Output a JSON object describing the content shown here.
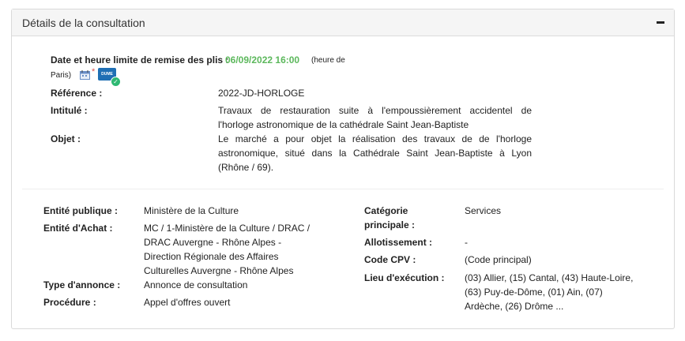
{
  "panel": {
    "title": "Détails de la consultation",
    "collapse_symbol": "−"
  },
  "deadline": {
    "label": "Date et heure limite de remise des plis :",
    "value": "06/09/2022 16:00",
    "tz_part1": "(heure de",
    "tz_part2": "Paris)",
    "icons": [
      "calendar-icon",
      "required-star-icon",
      "dume-icon"
    ],
    "dume_text": "DUME",
    "star": "*"
  },
  "reference": {
    "label": "Référence :",
    "value": "2022-JD-HORLOGE"
  },
  "intitule": {
    "label": "Intitulé :",
    "lines": [
      "Travaux de restauration suite à l'empoussièrement accidentel de",
      "l'horloge astronomique de la cathédrale Saint Jean-Baptiste"
    ]
  },
  "objet": {
    "label": "Objet :",
    "lines": [
      "Le marché a pour objet la réalisation des travaux de de l'horloge",
      "astronomique, situé dans la Cathédrale Saint Jean-Baptiste à Lyon",
      "(Rhône / 69)."
    ]
  },
  "entite_publique": {
    "label": "Entité publique :",
    "value": "Ministère de la Culture"
  },
  "entite_achat": {
    "label": "Entité d'Achat :",
    "lines": [
      "MC / 1-Ministère de la Culture / DRAC /",
      "DRAC Auvergne - Rhône Alpes -",
      "Direction Régionale des Affaires",
      "Culturelles Auvergne - Rhône Alpes"
    ]
  },
  "type_annonce": {
    "label": "Type d'annonce :",
    "value": "Annonce de consultation"
  },
  "procedure": {
    "label": "Procédure :",
    "value": "Appel d'offres ouvert"
  },
  "categorie": {
    "label_line1": "Catégorie",
    "label_line2": "principale :",
    "value": "Services"
  },
  "allotissement": {
    "label": "Allotissement :",
    "value": "-"
  },
  "code_cpv": {
    "label": "Code CPV :",
    "value": "(Code principal)"
  },
  "lieu": {
    "label": "Lieu d'exécution :",
    "lines": [
      "(03) Allier, (15) Cantal, (43) Haute-Loire,",
      "(63) Puy-de-Dôme, (01) Ain, (07)",
      "Ardèche, (26) Drôme ..."
    ]
  }
}
